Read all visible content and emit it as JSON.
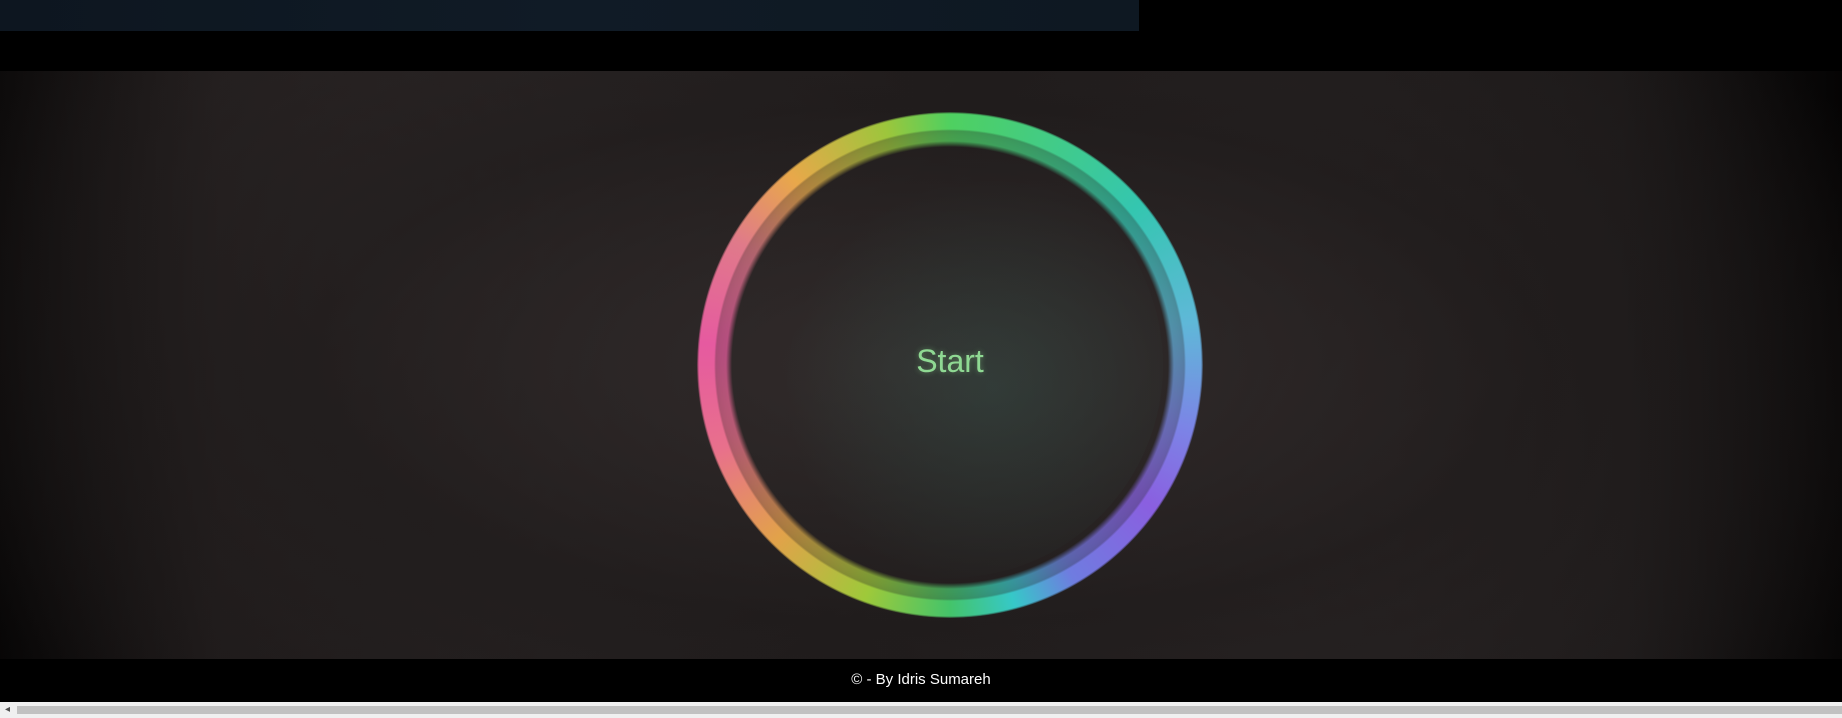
{
  "main": {
    "start_label": "Start"
  },
  "footer": {
    "credit": "© - By Idris Sumareh"
  },
  "scrollbar": {
    "left_arrow_glyph": "◂"
  },
  "colors": {
    "ring_green": "#4fd060",
    "ring_blue": "#7c84e6",
    "ring_pink": "#e65aa0",
    "ring_orange": "#e2a24a",
    "start_text": "#8fd993",
    "footer_text": "#ffffff",
    "background": "#000000"
  },
  "icons": {
    "scroll_left": "chevron-left-icon"
  }
}
